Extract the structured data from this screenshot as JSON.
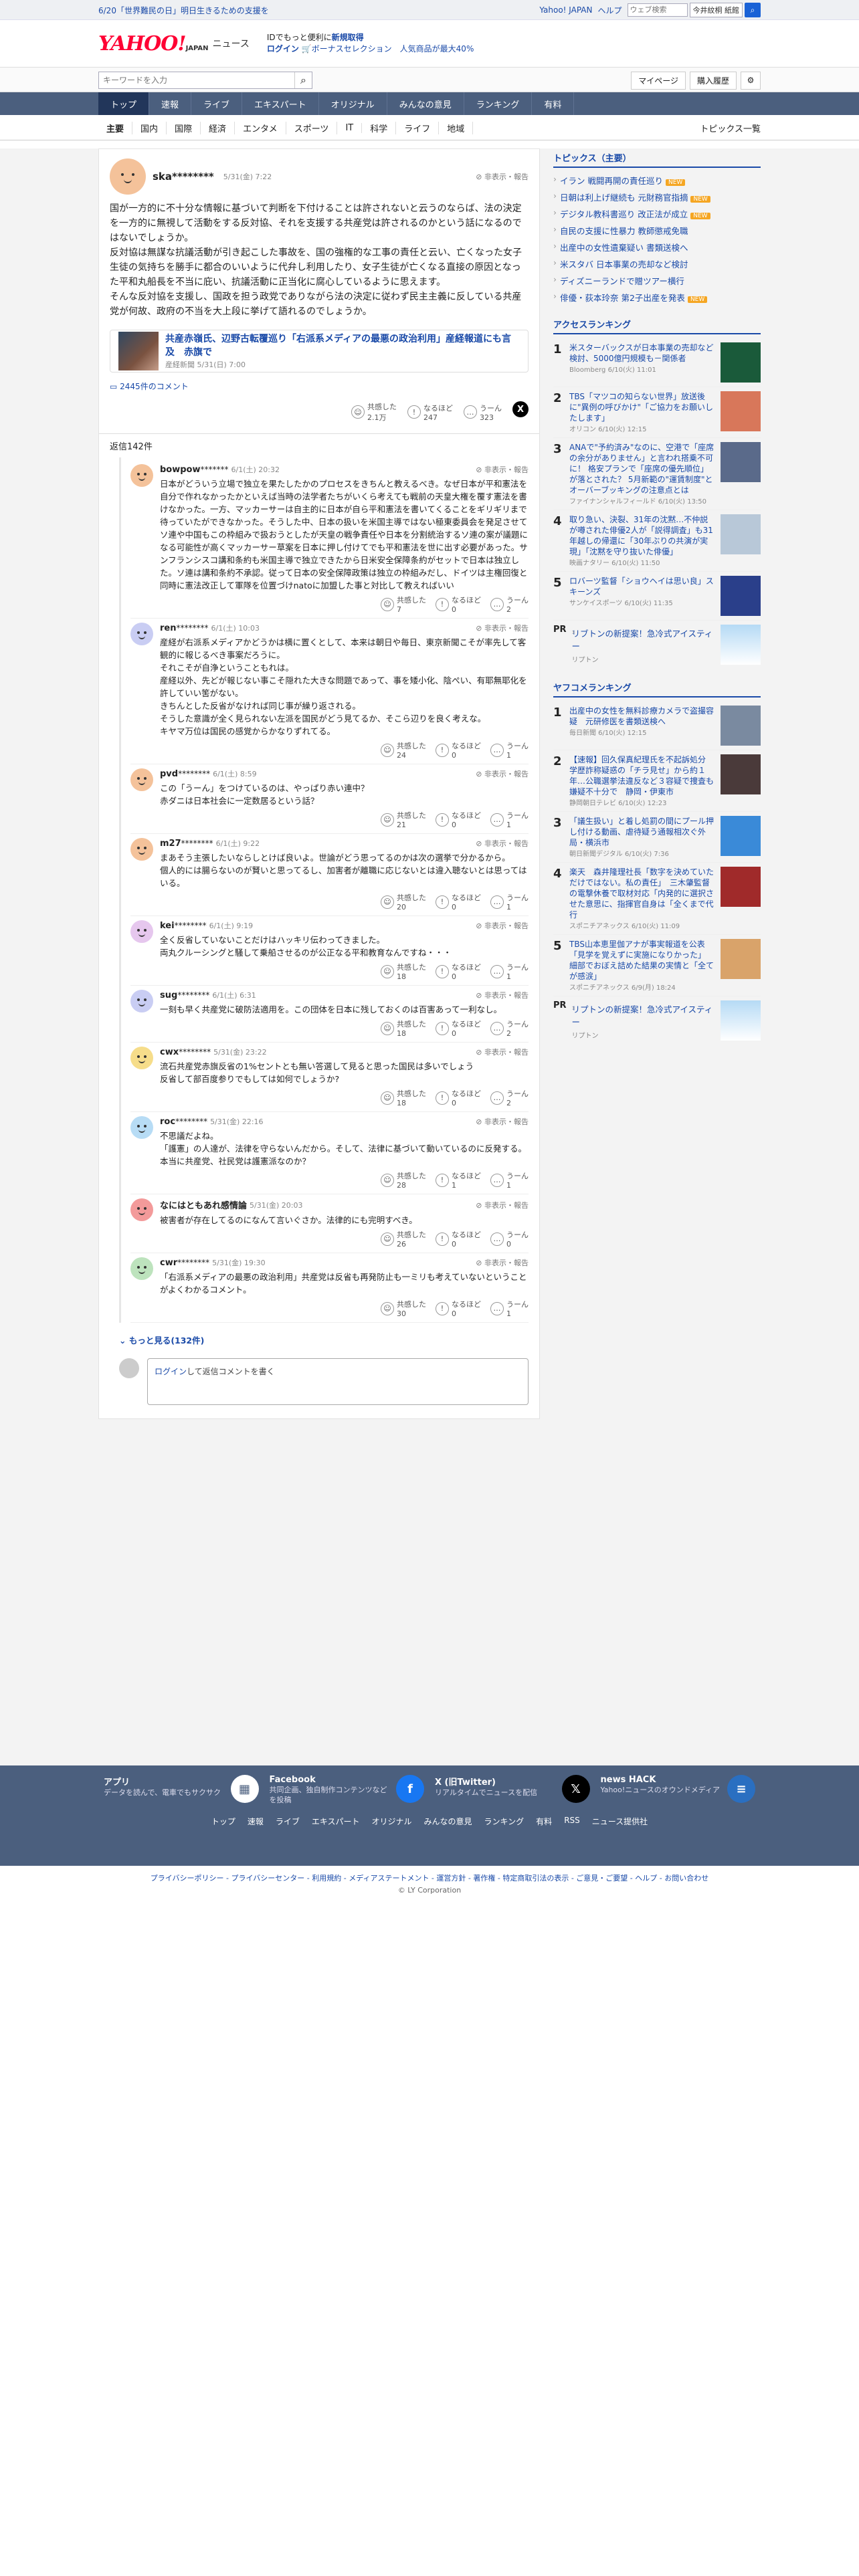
{
  "promo": {
    "text": "6/20「世界難民の日」明日生きるための支援を",
    "links": [
      "Yahoo! JAPAN",
      "ヘルプ"
    ],
    "search_placeholder": "ウェブ検索",
    "toggle": "今ページ検索 - 切り替え",
    "toggle_short": "今井紋桐 紙館"
  },
  "brand": {
    "logo": "YAHOO!",
    "logo_sub": "JAPAN",
    "service": "ニュース",
    "line1": "IDでもっと便利に",
    "line1b": "新規取得",
    "line2a": "ログイン",
    "line2b": "ボーナスセレクション",
    "line2c": "人気商品が最大40%"
  },
  "bar": {
    "placeholder": "キーワードを入力",
    "mypage": "マイページ",
    "history": "購入履歴"
  },
  "gnav": [
    "トップ",
    "速報",
    "ライブ",
    "エキスパート",
    "オリジナル",
    "みんなの意見",
    "ランキング",
    "有料"
  ],
  "snav": [
    "主要",
    "国内",
    "国際",
    "経済",
    "エンタメ",
    "スポーツ",
    "IT",
    "科学",
    "ライフ",
    "地域"
  ],
  "snav_more": "トピックス一覧",
  "main_comment": {
    "user": "ska********",
    "time": "5/31(金) 7:22",
    "report": "非表示・報告",
    "text": "国が一方的に不十分な情報に基づいて判断を下付けることは許されないと云うのならば、法の決定を一方的に無視して活動をする反対協、それを支援する共産党は許されるのかという話になるのではないでしょうか。\n反対協は無謀な抗議活動が引き起こした事故を、国の強権的な工事の責任と云い、亡くなった女子生徒の気持ちを勝手に都合のいいように代弁し利用したり、女子生徒が亡くなる直接の原因となった平和丸船長を不当に庇い、抗議活動に正当化に腐心しているように思えます。\nそんな反対協を支援し、国政を担う政党でありながら法の決定に従わず民主主義に反している共産党が何故、政府の不当を大上段に挙げて語れるのでしょうか。",
    "article_title": "共産赤嶺氏、辺野古転覆巡り「右派系メディアの最悪の政治利用」産経報道にも言及　赤旗で",
    "article_src": "産経新聞 5/31(日) 7:00",
    "comment_count": "2445件のコメント",
    "reactions": [
      {
        "label": "共感した",
        "v": "2.1万"
      },
      {
        "label": "なるほど",
        "v": "247"
      },
      {
        "label": "うーん",
        "v": "323"
      }
    ]
  },
  "reply_count": "返信142件",
  "replies": [
    {
      "user": "bowpow",
      "stars": "*******",
      "time": "6/1(土) 20:32",
      "text": "日本がどういう立場で独立を果たしたかのプロセスをきちんと教えるべき。なぜ日本が平和憲法を自分で作れなかったかといえば当時の法学者たちがいくら考えても戦前の天皇大権を覆す憲法を書けなかった。一方、マッカーサーは自主的に日本が自ら平和憲法を書いてくることをギリギリまで待っていたができなかった。そうした中、日本の扱いを米国主導ではない極東委員会を発足させてソ連や中国もこの枠組みで扱おうとしたが天皇の戦争責任や日本を分割統治するソ連の案が議題になる可能性が高くマッカーサー草案を日本に押し付けてでも平和憲法を世に出す必要があった。サンフランシスコ講和条約も米国主導で独立できたから日米安全保障条約がセットで日本は独立した。ソ連は講和条約不承認。従って日本の安全保障政策は独立の枠組みだし、ドイツは主権回復と同時に憲法改正して軍隊を位置づけnatoに加盟した事と対比して教えればいい",
      "r": [
        "7",
        "0",
        "2"
      ],
      "c": "#f4c29a"
    },
    {
      "user": "ren",
      "stars": "********",
      "time": "6/1(土) 10:03",
      "text": "産経が右派系メディアかどうかは横に置くとして、本来は朝日や毎日、東京新聞こそが率先して客観的に報じるべき事案だろうに。\nそれこそが自浄ということもれは。\n産経以外、先どが報じない事こそ隠れた大きな問題であって、事を矮小化、陰ぺい、有耶無耶化を許していい筈がない。\nきちんとした反省がなければ同じ事が繰り返される。\nそうした意識が全く見られない左派を国民がどう見てるか、そこら辺りを良く考えな。\nキヤマ万位は国民の感覚からかなりずれてる。",
      "r": [
        "24",
        "0",
        "1"
      ],
      "c": "#c9cdf3"
    },
    {
      "user": "pvd",
      "stars": "********",
      "time": "6/1(土) 8:59",
      "text": "この「うーん」をつけているのは、やっぱり赤い連中？\n赤ダニは日本社会に一定数居るという話？",
      "r": [
        "21",
        "0",
        "1"
      ],
      "c": "#f4c29a"
    },
    {
      "user": "m27",
      "stars": "********",
      "time": "6/1(土) 9:22",
      "text": "まあそう主張したいならしとけば良いよ。世論がどう思ってるのかは次の選挙で分かるから。\n個人的には腸らないのが賢いと思ってるし、加害者が離職に応じないとは違入聴ないとは思ってはいる。",
      "r": [
        "20",
        "0",
        "1"
      ],
      "c": "#f4c29a"
    },
    {
      "user": "kei",
      "stars": "********",
      "time": "6/1(土) 9:19",
      "text": "全く反省していないことだけはハッキリ伝わってきました。\n両丸クルーシングと騒して乗船させるのが公正なる平和教育なんですね・・・",
      "r": [
        "18",
        "0",
        "1"
      ],
      "c": "#e6c7ee"
    },
    {
      "user": "sug",
      "stars": "********",
      "time": "6/1(土) 6:31",
      "text": "一刻も早く共産党に破防法適用を。この団体を日本に残しておくのは百害あって一利なし。",
      "r": [
        "18",
        "0",
        "2"
      ],
      "c": "#c9cdf3"
    },
    {
      "user": "cwx",
      "stars": "********",
      "time": "5/31(金) 23:22",
      "text": "流石共産党赤旗反省の1%セントとも無い答選して見ると思った国民は多いでしょう\n反省して部百度参りでもしては如何でしょうか?",
      "r": [
        "18",
        "0",
        "2"
      ],
      "c": "#f6dd8a"
    },
    {
      "user": "roc",
      "stars": "********",
      "time": "5/31(金) 22:16",
      "text": "不思議だよね。\n「護憲」の人達が、法律を守らないんだから。そして、法律に基づいて動いているのに反発する。本当に共産党、社民党は護憲派なのか？",
      "r": [
        "28",
        "1",
        "1"
      ],
      "c": "#b7dcf5"
    },
    {
      "user": "なにはともあれ感情論",
      "stars": "",
      "time": "5/31(金) 20:03",
      "text": "被害者が存在してるのになんて言いぐさか。法律的にも完明すべき。",
      "r": [
        "26",
        "0",
        "0"
      ],
      "c": "#f39a9a"
    },
    {
      "user": "cwr",
      "stars": "********",
      "time": "5/31(金) 19:30",
      "text": "「右派系メディアの最悪の政治利用」共産党は反省も再発防止も一ミリも考えていないということがよくわかるコメント。",
      "r": [
        "30",
        "0",
        "1"
      ],
      "c": "#bde3bd"
    }
  ],
  "more": "もっと見る(132件)",
  "compose": {
    "login": "ログイン",
    "text": "して返信コメントを書く"
  },
  "topics": {
    "title": "トピックス（主要）",
    "items": [
      "イラン 戦闘再開の責任巡り",
      "日朝は利上げ継続も 元財務官指摘",
      "デジタル教科書巡り 改正法が成立",
      "自民の支援に性暴力 教師懲戒免職",
      "出産中の女性遺棄疑い 書類送検へ",
      "米スタバ 日本事業の売却など検討",
      "ディズニーランドで贈ツアー横行",
      "俳優・荻本玲奈 第2子出産を発表"
    ]
  },
  "access": {
    "title": "アクセスランキング",
    "items": [
      {
        "t": "米スターバックスが日本事業の売却など検討、5000億円規模も－関係者",
        "s": "Bloomberg 6/10(火) 11:01",
        "c": "#1a5a3a"
      },
      {
        "t": "TBS「マツコの知らない世界」放送後に\"異例の呼びかけ\"「ご協力をお願いしたします」",
        "s": "オリコン 6/10(火) 12:15",
        "c": "#d8775a"
      },
      {
        "t": "ANAで\"予約済み\"なのに、空港で「座席の余分がありません」と言われ搭乗不可に！ 格安プランで「座席の優先順位」が落とされた？ 5月新範の\"運賃制度\"とオーバーブッキングの注意点とは",
        "s": "ファイナンシャルフィールド 6/10(火) 13:50",
        "c": "#5a6a8a"
      },
      {
        "t": "取り急い、決裂、31年の沈黙…不仲説が噂された俳優2人が「説得調査」も31年越しの帰還に「30年ぶりの共演が実現」「沈黙を守り抜いた俳優」",
        "s": "映画ナタリー 6/10(火) 11:50",
        "c": "#b8c8d8"
      },
      {
        "t": "ロバーツ監督「ショウヘイは思い良」スキーンズ",
        "s": "サンケイスポーツ 6/10(火) 11:35",
        "c": "#2a3f8a"
      }
    ]
  },
  "pr1": {
    "label": "PR",
    "t": "リブトンの新提案！急冷式アイスティー",
    "s": "リプトン"
  },
  "yahoo_rank": {
    "title": "ヤフコメランキング",
    "items": [
      {
        "t": "出産中の女性を無料診療カメラで盗撮容疑　元研修医を書類送検へ",
        "s": "毎日新聞 6/10(火) 12:15",
        "c": "#7a8aa0"
      },
      {
        "t": "【速報】回久保真紀理氏を不起訴処分　学歴詐称疑惑の「チラ見せ」から約１年…公職選挙法違反など３容疑で捜査も嫌疑不十分で　静岡・伊東市",
        "s": "静岡朝日テレビ 6/10(火) 12:23",
        "c": "#4a3a3a"
      },
      {
        "t": "「議生扱い」と着し処罰の間にプール押し付ける動画、虐待疑う通報相次ぐ外局・横浜市",
        "s": "朝日新聞デジタル 6/10(火) 7:36",
        "c": "#3a8ad8"
      },
      {
        "t": "楽天　森井隆理社長「数字を決めていただけではない。私の責任」　三木肇監督の電撃休養で取材対応「内発的に選択させた意思に、指揮官自身は「全くまで代行",
        "s": "スポニチアネックス 6/10(火) 11:09",
        "c": "#a02a2a"
      },
      {
        "t": "TBS山本恵里伽アナが事実報道を公表「見学を覚えずに実施になりかった」　細部でおぼえ詰めた結果の実情と「全てが感涙」",
        "s": "スポニチアネックス 6/9(月) 18:24",
        "c": "#d9a36a"
      }
    ]
  },
  "pr2": {
    "label": "PR",
    "t": "リプトンの新提案！急冷式アイスティー",
    "s": "リプトン"
  },
  "footer": {
    "items": [
      {
        "t": "アプリ",
        "d": "データを読んで、電車でもサクサク",
        "ic": "▦",
        "bg": "#fff",
        "fg": "#4b5f7e"
      },
      {
        "t": "Facebook",
        "d": "共同企画、独自制作コンテンツなどを投稿",
        "ic": "f",
        "bg": "#1877f2",
        "fg": "#fff"
      },
      {
        "t": "X (旧Twitter)",
        "d": "リアルタイムでニュースを配信",
        "ic": "𝕏",
        "bg": "#000",
        "fg": "#fff"
      },
      {
        "t": "news HACK",
        "d": "Yahoo!ニュースのオウンドメディア",
        "ic": "≡",
        "bg": "#2a6fc1",
        "fg": "#fff"
      }
    ],
    "links": [
      "トップ",
      "速報",
      "ライブ",
      "エキスパート",
      "オリジナル",
      "みんなの意見",
      "ランキング",
      "有料",
      "RSS",
      "ニュース提供社"
    ],
    "legal": "プライバシーポリシー - プライバシーセンター - 利用規約 - メディアステートメント - 運営方針 - 著作権 - 特定商取引法の表示 - ご意見・ご要望 - ヘルプ - お問い合わせ",
    "copy": "© LY Corporation"
  }
}
